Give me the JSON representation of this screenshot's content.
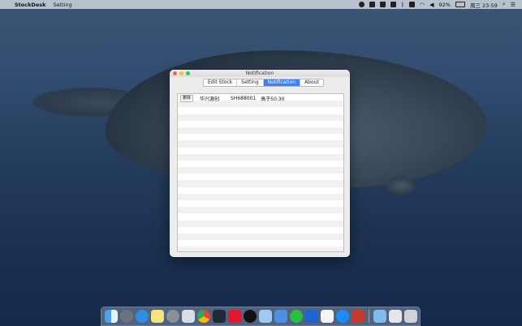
{
  "menubar": {
    "app_name": "StockDesk",
    "menu_item": "Setting",
    "battery": "92%",
    "clock": "周三 23:59"
  },
  "window": {
    "title": "Notification",
    "tabs": [
      {
        "label": "Edit Stock",
        "active": false
      },
      {
        "label": "Setting",
        "active": false
      },
      {
        "label": "Notification",
        "active": true
      },
      {
        "label": "About",
        "active": false
      }
    ],
    "notifications": [
      {
        "delete_label": "删除",
        "name": "华兴源创",
        "code": "SH688001",
        "condition": "高于50.30"
      }
    ]
  },
  "dock": {
    "apps": [
      "finder-icon",
      "launchpad-icon",
      "safari-icon",
      "notes-icon",
      "system-preferences-icon",
      "screenshot-icon",
      "chrome-icon",
      "terminal-icon",
      "weibo-icon",
      "qq-icon",
      "preview-icon",
      "xcode-icon",
      "iqiyi-icon",
      "maps-icon",
      "textedit-icon",
      "app-store-icon",
      "pdf-icon",
      "downloads-folder-icon",
      "window-icon",
      "trash-icon"
    ]
  },
  "colors": {
    "accent": "#3b82f6",
    "close": "#fc5f57",
    "minimize": "#fdbc2e",
    "zoom": "#33c748"
  }
}
